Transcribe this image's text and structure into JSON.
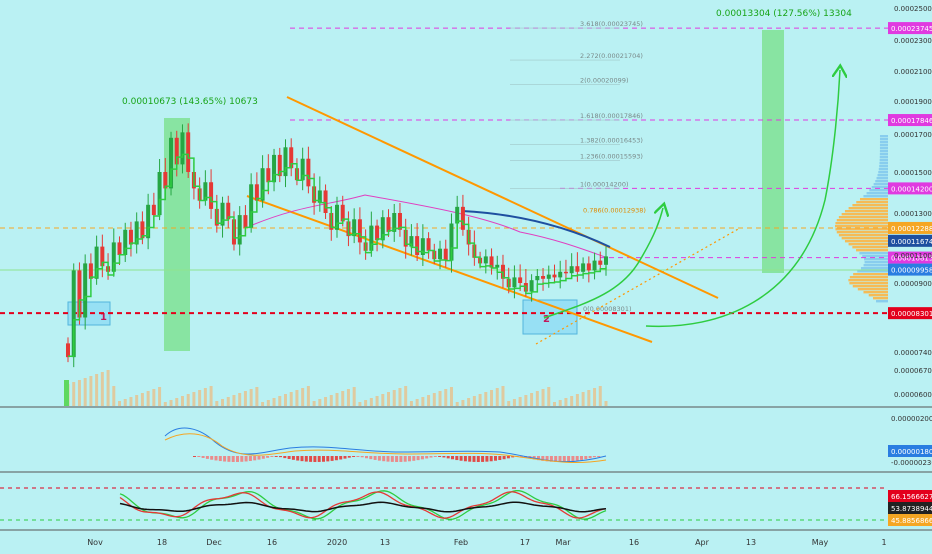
{
  "chart_data": {
    "type": "candlestick",
    "pair_note": "",
    "price_scale": {
      "min": 5.8e-05,
      "max": 0.000251,
      "ticks": [
        "0.00025000",
        "0.00023000",
        "0.00021000",
        "0.00019000",
        "0.00017000",
        "0.00015000",
        "0.00013000",
        "0.00011000",
        "0.00009000",
        "0.00007400",
        "0.00006700",
        "0.00006000"
      ]
    },
    "x_axis": {
      "labels": [
        "Nov",
        "18",
        "Dec",
        "16",
        "2020",
        "13",
        "Feb",
        "17",
        "Mar",
        "16",
        "Apr",
        "13",
        "May",
        "1"
      ]
    },
    "price_markers": [
      {
        "value": "0.00023745",
        "color": "#e03ae0",
        "style": "dashed"
      },
      {
        "value": "0.00017846",
        "color": "#e03ae0",
        "style": "dashed"
      },
      {
        "value": "0.00014200",
        "color": "#e03ae0",
        "style": "dashed"
      },
      {
        "value": "0.00012288",
        "color": "#f5a623",
        "style": "dashed"
      },
      {
        "value": "0.00011674",
        "color": "#1e4fa0",
        "style": "solid"
      },
      {
        "value": "0.00010815",
        "color": "#e03ae0",
        "style": "dashed"
      },
      {
        "value": "0.00009958",
        "color": "#2a7de1",
        "style": "solid"
      },
      {
        "value": "0.00008301",
        "color": "#e3001b",
        "style": "dashed"
      }
    ],
    "fib_levels": [
      {
        "label": "3.618(0.00023745)",
        "value": 0.00023745
      },
      {
        "label": "2.272(0.00021704)",
        "value": 0.00021704
      },
      {
        "label": "2(0.00020099)",
        "value": 0.00020099
      },
      {
        "label": "1.618(0.00017846)",
        "value": 0.00017846
      },
      {
        "label": "1.382(0.00016453)",
        "value": 0.00016453
      },
      {
        "label": "1.236(0.00015593)",
        "value": 0.00015593
      },
      {
        "label": "1(0.00014200)",
        "value": 0.000142
      },
      {
        "label": "0.786(0.00012938)",
        "value": 0.00012938
      },
      {
        "label": "0(0.00008301)",
        "value": 8.301e-05
      }
    ],
    "measurements": [
      {
        "label": "0.00010673 (143.65%) 10673"
      },
      {
        "label": "0.00013304 (127.56%) 13304"
      }
    ],
    "annotations": [
      "1",
      "2"
    ],
    "macd_scale": {
      "ticks": [
        "0.00000200",
        "0.00000180",
        "-0.00000230"
      ]
    },
    "rsi_scale": {
      "ticks": [
        "66.15666274",
        "53.87389441",
        "45.88568667"
      ]
    },
    "candles": [
      [
        7.6,
        7.2
      ],
      [
        7.2,
        9.9
      ],
      [
        9.9,
        8.2
      ],
      [
        8.2,
        10.4
      ],
      [
        10.4,
        9.3
      ],
      [
        9.3,
        11.4
      ],
      [
        11.4,
        10.2
      ],
      [
        10.2,
        9.8
      ],
      [
        9.8,
        11.6
      ],
      [
        11.6,
        11.0
      ],
      [
        11.0,
        12.2
      ],
      [
        12.2,
        11.5
      ],
      [
        11.5,
        12.6
      ],
      [
        12.6,
        11.8
      ],
      [
        11.8,
        13.4
      ],
      [
        13.4,
        12.9
      ],
      [
        12.9,
        15.0
      ],
      [
        15.0,
        14.2
      ],
      [
        14.2,
        16.8
      ],
      [
        16.8,
        15.4
      ],
      [
        15.4,
        17.1
      ],
      [
        17.1,
        15.0
      ],
      [
        15.0,
        14.2
      ],
      [
        14.2,
        13.6
      ],
      [
        13.6,
        14.5
      ],
      [
        14.5,
        13.2
      ],
      [
        13.2,
        12.4
      ],
      [
        12.4,
        13.5
      ],
      [
        13.5,
        12.7
      ],
      [
        12.7,
        11.5
      ],
      [
        11.5,
        12.9
      ],
      [
        12.9,
        12.3
      ],
      [
        12.3,
        14.4
      ],
      [
        14.4,
        13.6
      ],
      [
        13.6,
        15.2
      ],
      [
        15.2,
        14.5
      ],
      [
        14.5,
        15.9
      ],
      [
        15.9,
        14.8
      ],
      [
        14.8,
        16.3
      ],
      [
        16.3,
        15.2
      ],
      [
        15.2,
        14.6
      ],
      [
        14.6,
        15.7
      ],
      [
        15.7,
        14.3
      ],
      [
        14.3,
        13.5
      ],
      [
        13.5,
        14.1
      ],
      [
        14.1,
        13.0
      ],
      [
        13.0,
        12.2
      ],
      [
        12.2,
        13.4
      ],
      [
        13.4,
        12.6
      ],
      [
        12.6,
        11.9
      ],
      [
        11.9,
        12.7
      ],
      [
        12.7,
        11.6
      ],
      [
        11.6,
        11.2
      ],
      [
        11.2,
        12.4
      ],
      [
        12.4,
        11.7
      ],
      [
        11.7,
        12.8
      ],
      [
        12.8,
        12.1
      ],
      [
        12.1,
        13.0
      ],
      [
        13.0,
        12.2
      ],
      [
        12.2,
        11.4
      ],
      [
        11.4,
        11.9
      ],
      [
        11.9,
        11.0
      ],
      [
        11.0,
        11.8
      ],
      [
        11.8,
        11.2
      ],
      [
        11.2,
        10.7
      ],
      [
        10.7,
        11.3
      ],
      [
        11.3,
        10.6
      ],
      [
        10.6,
        12.5
      ],
      [
        12.5,
        13.3
      ],
      [
        13.3,
        12.2
      ],
      [
        12.2,
        11.5
      ],
      [
        11.5,
        10.8
      ],
      [
        10.8,
        10.4
      ],
      [
        10.4,
        10.9
      ],
      [
        10.9,
        10.1
      ],
      [
        10.1,
        10.3
      ],
      [
        10.3,
        9.3
      ],
      [
        9.3,
        8.9
      ],
      [
        8.9,
        9.4
      ],
      [
        9.4,
        9.0
      ],
      [
        9.0,
        8.8
      ],
      [
        8.8,
        9.2
      ],
      [
        9.2,
        9.5
      ],
      [
        9.5,
        9.3
      ],
      [
        9.3,
        9.6
      ],
      [
        9.6,
        9.4
      ],
      [
        9.4,
        9.8
      ],
      [
        9.8,
        9.7
      ],
      [
        9.7,
        10.2
      ],
      [
        10.2,
        9.8
      ],
      [
        9.8,
        10.4
      ],
      [
        10.4,
        9.9
      ],
      [
        9.9,
        10.6
      ],
      [
        10.6,
        10.3
      ],
      [
        10.3,
        10.9
      ]
    ],
    "candle_unit": "1e-5"
  }
}
